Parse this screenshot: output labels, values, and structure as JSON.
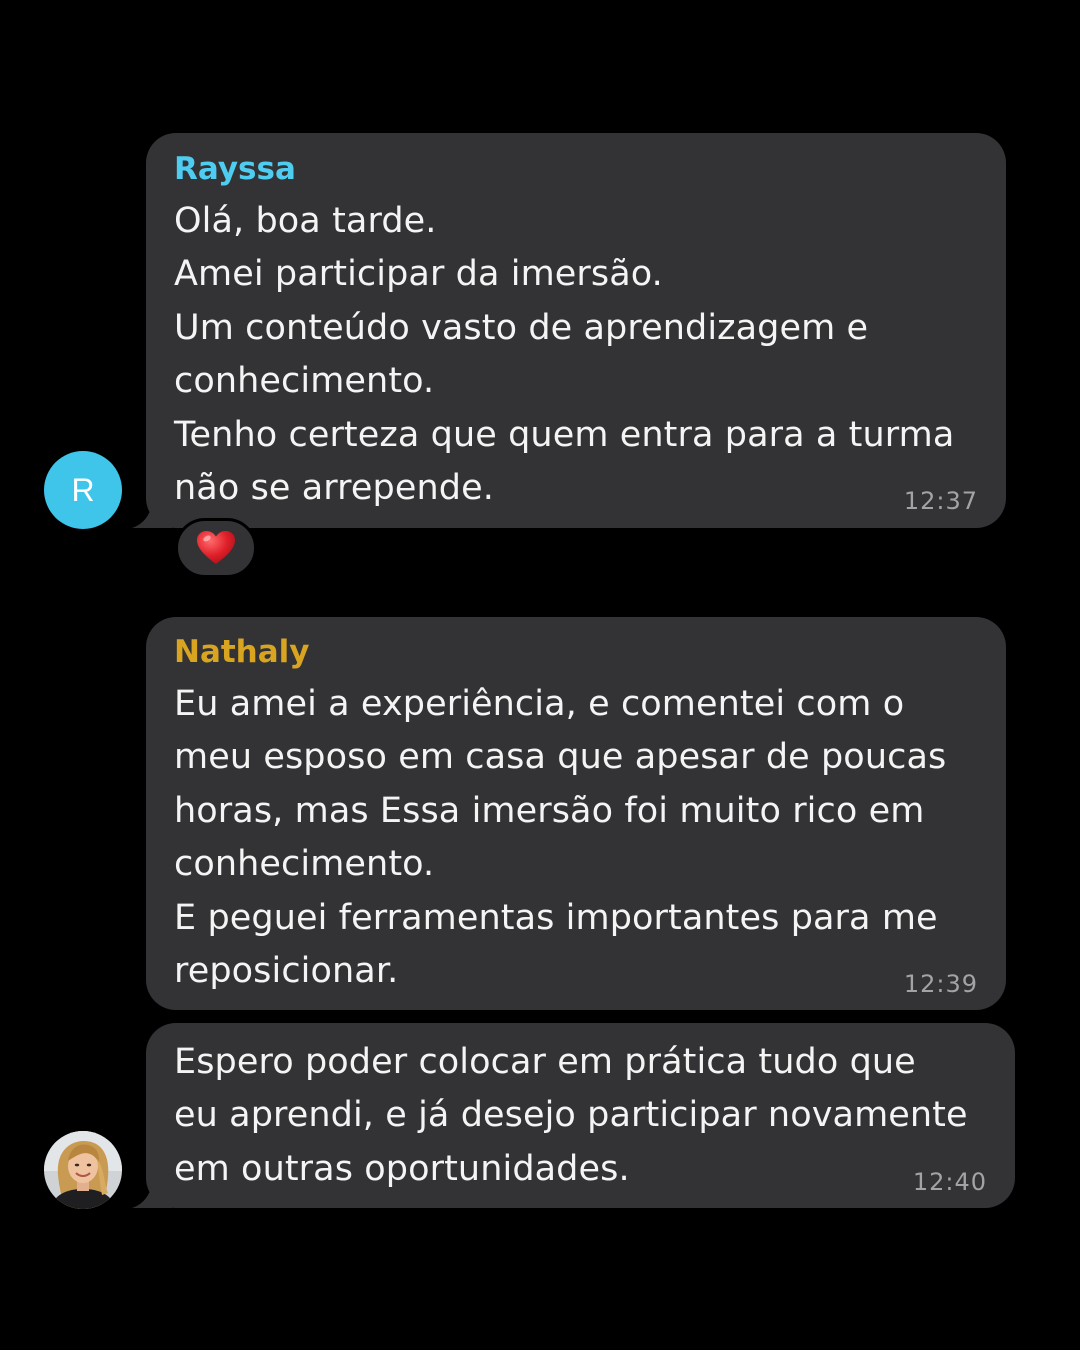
{
  "colors": {
    "background": "#000000",
    "bubble": "#333335",
    "message_text": "#f4f4f4",
    "time_text": "#a3a3a6",
    "rayssa_name": "#4ecdf0",
    "nathaly_name": "#d9a520",
    "avatar_r": "#3fc4ea",
    "heart": "#e0202a"
  },
  "messages": [
    {
      "sender": "Rayssa",
      "lines": [
        "Olá, boa tarde.",
        "Amei participar da imersão.",
        "Um conteúdo vasto de aprendizagem e",
        "conhecimento.",
        "Tenho certeza que quem entra para a turma",
        "não se arrepende."
      ],
      "time": "12:37",
      "avatar_letter": "R",
      "reaction_icon": "red-heart-icon"
    },
    {
      "sender": "Nathaly",
      "lines": [
        "Eu amei a experiência, e comentei com o",
        "meu esposo em casa que apesar de poucas",
        "horas, mas Essa imersão foi muito rico em",
        "conhecimento.",
        "E peguei ferramentas importantes para me",
        "reposicionar."
      ],
      "time": "12:39"
    },
    {
      "lines": [
        "Espero poder colocar em prática tudo que",
        "eu aprendi, e já desejo participar novamente",
        "em outras oportunidades."
      ],
      "time": "12:40",
      "avatar": "profile-photo"
    }
  ]
}
